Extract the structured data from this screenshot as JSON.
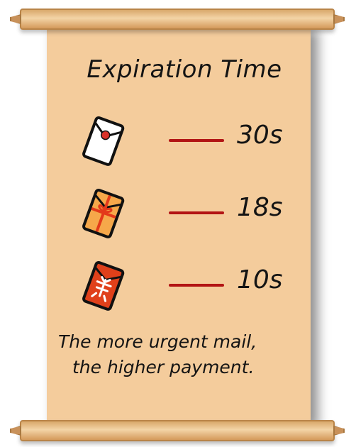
{
  "title": "Expiration Time",
  "items": [
    {
      "icon": "white-envelope-icon",
      "time": "30s",
      "color": "#ffffff"
    },
    {
      "icon": "gift-envelope-icon",
      "time": "18s",
      "color": "#f6a84a"
    },
    {
      "icon": "red-envelope-icon",
      "time": "10s",
      "color": "#e0401a"
    }
  ],
  "note": {
    "line1": "The more urgent mail,",
    "line2": "the higher payment."
  },
  "colors": {
    "paper": "#f4cc9c",
    "dash": "#b21414"
  }
}
